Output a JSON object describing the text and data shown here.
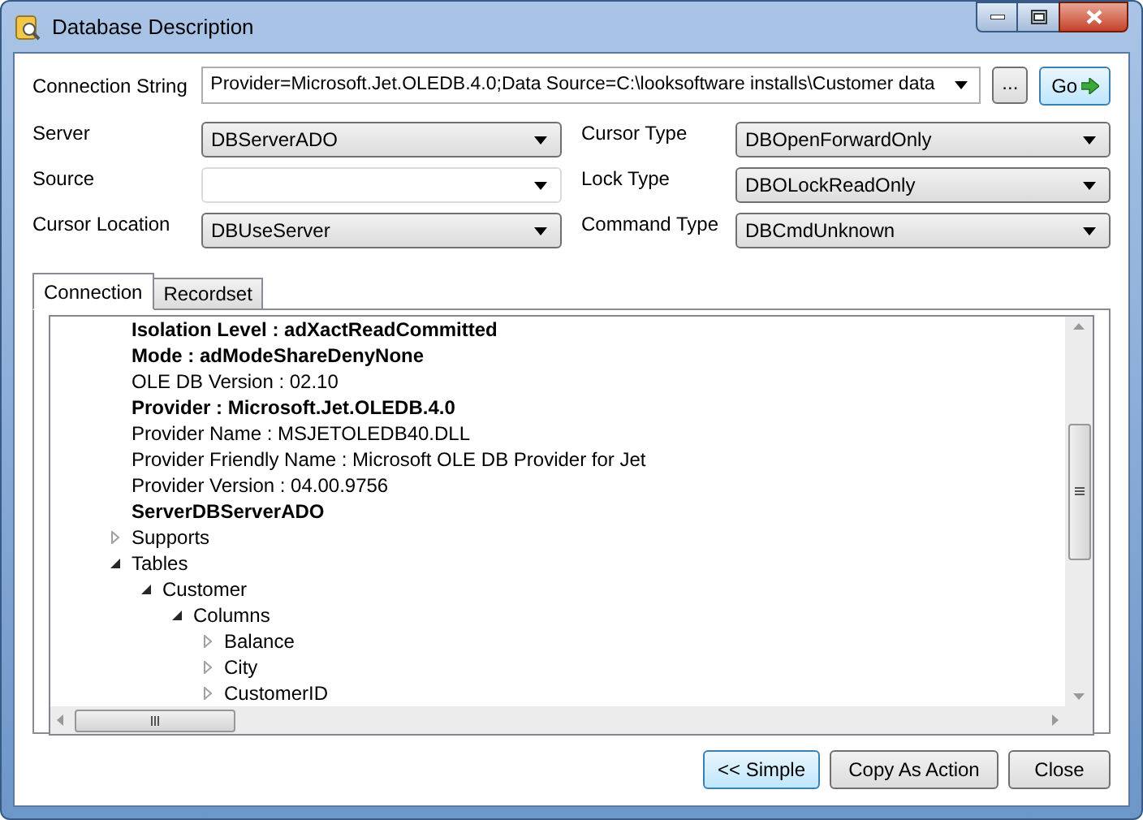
{
  "window": {
    "title": "Database Description"
  },
  "connection_string": {
    "label": "Connection String",
    "value": "Provider=Microsoft.Jet.OLEDB.4.0;Data Source=C:\\looksoftware installs\\Customer data",
    "browse_button": "...",
    "go_button": "Go"
  },
  "fields_left": [
    {
      "label": "Server",
      "value": "DBServerADO",
      "disabled": false
    },
    {
      "label": "Source",
      "disabled": true
    },
    {
      "label": "Cursor Location",
      "value": "DBUseServer",
      "disabled": false
    }
  ],
  "fields_right": [
    {
      "label": "Cursor Type",
      "value": "DBOpenForwardOnly",
      "disabled": false
    },
    {
      "label": "Lock Type",
      "value": "DBOLockReadOnly",
      "disabled": false
    },
    {
      "label": "Command Type",
      "value": "DBCmdUnknown",
      "disabled": false
    }
  ],
  "tabs": [
    {
      "label": "Connection",
      "selected": true
    },
    {
      "label": "Recordset",
      "selected": false
    }
  ],
  "tree": [
    {
      "kind": "property",
      "label": "Isolation Level : adXactReadCommitted",
      "bold": true
    },
    {
      "kind": "property",
      "label": "Mode : adModeShareDenyNone",
      "bold": true
    },
    {
      "kind": "property",
      "label": "OLE DB Version : 02.10",
      "bold": false
    },
    {
      "kind": "property",
      "label": "Provider : Microsoft.Jet.OLEDB.4.0",
      "bold": true
    },
    {
      "kind": "property",
      "label": "Provider Name : MSJETOLEDB40.DLL",
      "bold": false
    },
    {
      "kind": "property",
      "label": "Provider Friendly Name : Microsoft OLE DB Provider for Jet",
      "bold": false
    },
    {
      "kind": "property",
      "label": "Provider Version : 04.00.9756",
      "bold": false
    },
    {
      "kind": "property",
      "label": "ServerDBServerADO",
      "bold": true
    },
    {
      "kind": "node",
      "label": "Supports",
      "expanded": false
    },
    {
      "kind": "node",
      "label": "Tables",
      "expanded": true,
      "children": [
        {
          "kind": "node",
          "label": "Customer",
          "expanded": true,
          "children": [
            {
              "kind": "node",
              "label": "Columns",
              "expanded": true,
              "children": [
                {
                  "kind": "node",
                  "label": "Balance",
                  "expanded": false
                },
                {
                  "kind": "node",
                  "label": "City",
                  "expanded": false
                },
                {
                  "kind": "node",
                  "label": "CustomerID",
                  "expanded": false
                }
              ]
            }
          ]
        }
      ]
    }
  ],
  "buttons": [
    {
      "label": "<< Simple",
      "selected": true
    },
    {
      "label": "Copy As Action",
      "selected": false
    },
    {
      "label": "Close",
      "selected": false
    }
  ]
}
